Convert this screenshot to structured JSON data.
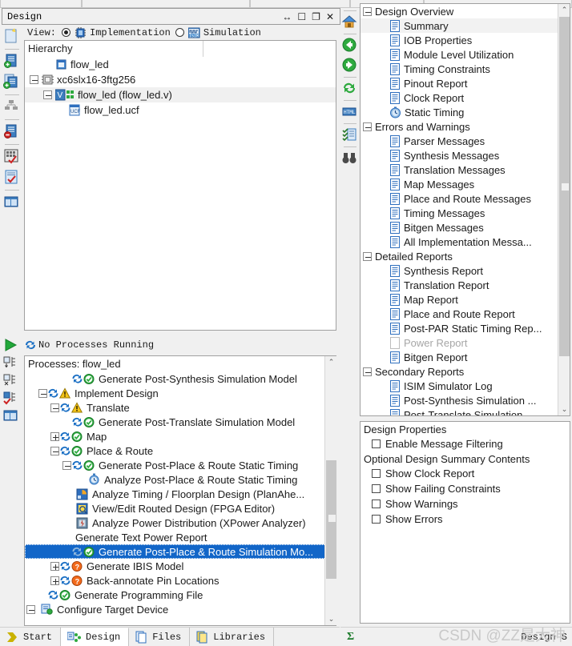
{
  "window": {
    "title": "Design",
    "buttons": [
      {
        "name": "resize-handle-icon",
        "glyph": "↔"
      },
      {
        "name": "maximize-icon",
        "glyph": "☐"
      },
      {
        "name": "restore-icon",
        "glyph": "❐"
      },
      {
        "name": "close-icon",
        "glyph": "✕"
      }
    ]
  },
  "view_selector": {
    "label": "View:",
    "options": [
      {
        "label": "Implementation",
        "selected": true,
        "icon": "chip-icon"
      },
      {
        "label": "Simulation",
        "selected": false,
        "icon": "waveform-icon"
      }
    ]
  },
  "hierarchy": {
    "header": "Hierarchy",
    "items": [
      {
        "label": "flow_led",
        "indent": 1,
        "toggle": "none",
        "icon": "project-icon",
        "selected": false
      },
      {
        "label": "xc6slx16-3ftg256",
        "indent": 0,
        "toggle": "minus",
        "icon": "device-icon",
        "selected": false
      },
      {
        "label": "flow_led (flow_led.v)",
        "indent": 1,
        "toggle": "minus",
        "icon": "verilog-module-icon",
        "selected": true
      },
      {
        "label": "flow_led.ucf",
        "indent": 2,
        "toggle": "none",
        "icon": "ucf-file-icon",
        "selected": false
      }
    ]
  },
  "processes": {
    "status": "No Processes Running",
    "title": "Processes: flow_led",
    "items": [
      {
        "label": "Generate Post-Synthesis Simulation Model",
        "indent": 3,
        "toggle": "none",
        "status": "ok",
        "icon": "process-icon",
        "selected": false
      },
      {
        "label": "Implement Design",
        "indent": 1,
        "toggle": "minus",
        "status": "warn",
        "icon": "process-icon",
        "selected": false
      },
      {
        "label": "Translate",
        "indent": 2,
        "toggle": "minus",
        "status": "warn",
        "icon": "process-icon",
        "selected": false
      },
      {
        "label": "Generate Post-Translate Simulation Model",
        "indent": 3,
        "toggle": "none",
        "status": "ok",
        "icon": "process-icon",
        "selected": false
      },
      {
        "label": "Map",
        "indent": 2,
        "toggle": "plus",
        "status": "ok",
        "icon": "process-icon",
        "selected": false
      },
      {
        "label": "Place & Route",
        "indent": 2,
        "toggle": "minus",
        "status": "ok",
        "icon": "process-icon",
        "selected": false
      },
      {
        "label": "Generate Post-Place & Route Static Timing",
        "indent": 3,
        "toggle": "minus",
        "status": "ok",
        "icon": "process-icon",
        "selected": false
      },
      {
        "label": "Analyze Post-Place & Route Static Timing",
        "indent": 4,
        "toggle": "none",
        "status": "none",
        "icon": "stopwatch-icon",
        "selected": false
      },
      {
        "label": "Analyze Timing / Floorplan Design (PlanAhe...",
        "indent": 3,
        "toggle": "none",
        "status": "none",
        "icon": "planahead-icon",
        "selected": false
      },
      {
        "label": "View/Edit Routed Design (FPGA Editor)",
        "indent": 3,
        "toggle": "none",
        "status": "none",
        "icon": "fpga-editor-icon",
        "selected": false
      },
      {
        "label": "Analyze Power Distribution (XPower Analyzer)",
        "indent": 3,
        "toggle": "none",
        "status": "none",
        "icon": "xpower-icon",
        "selected": false
      },
      {
        "label": "Generate Text Power Report",
        "indent": 3,
        "toggle": "none",
        "status": "none",
        "icon": "process-icon",
        "selected": false
      },
      {
        "label": "Generate Post-Place & Route Simulation Mo...",
        "indent": 3,
        "toggle": "none",
        "status": "ok",
        "icon": "process-icon",
        "selected": true
      },
      {
        "label": "Generate IBIS Model",
        "indent": 2,
        "toggle": "plus",
        "status": "question",
        "icon": "process-icon",
        "selected": false
      },
      {
        "label": "Back-annotate Pin Locations",
        "indent": 2,
        "toggle": "plus",
        "status": "question",
        "icon": "process-icon",
        "selected": false
      },
      {
        "label": "Generate Programming File",
        "indent": 1,
        "toggle": "none",
        "status": "ok",
        "icon": "process-icon",
        "selected": false
      },
      {
        "label": "Configure Target Device",
        "indent": 0,
        "toggle": "minus",
        "status": "none",
        "icon": "configure-icon",
        "selected": false
      }
    ]
  },
  "design_overview": {
    "items": [
      {
        "label": "Design Overview",
        "indent": 0,
        "toggle": "minus",
        "icon": "none",
        "selected": false,
        "disabled": false
      },
      {
        "label": "Summary",
        "indent": 1,
        "toggle": "none",
        "icon": "report-icon",
        "selected": true,
        "disabled": false
      },
      {
        "label": "IOB Properties",
        "indent": 1,
        "toggle": "none",
        "icon": "report-icon",
        "selected": false,
        "disabled": false
      },
      {
        "label": "Module Level Utilization",
        "indent": 1,
        "toggle": "none",
        "icon": "report-icon",
        "selected": false,
        "disabled": false
      },
      {
        "label": "Timing Constraints",
        "indent": 1,
        "toggle": "none",
        "icon": "report-icon",
        "selected": false,
        "disabled": false
      },
      {
        "label": "Pinout Report",
        "indent": 1,
        "toggle": "none",
        "icon": "report-icon",
        "selected": false,
        "disabled": false
      },
      {
        "label": "Clock Report",
        "indent": 1,
        "toggle": "none",
        "icon": "report-icon",
        "selected": false,
        "disabled": false
      },
      {
        "label": "Static Timing",
        "indent": 1,
        "toggle": "none",
        "icon": "static-timing-icon",
        "selected": false,
        "disabled": false
      },
      {
        "label": "Errors and Warnings",
        "indent": 0,
        "toggle": "minus",
        "icon": "none",
        "selected": false,
        "disabled": false
      },
      {
        "label": "Parser Messages",
        "indent": 1,
        "toggle": "none",
        "icon": "report-icon",
        "selected": false,
        "disabled": false
      },
      {
        "label": "Synthesis Messages",
        "indent": 1,
        "toggle": "none",
        "icon": "report-icon",
        "selected": false,
        "disabled": false
      },
      {
        "label": "Translation Messages",
        "indent": 1,
        "toggle": "none",
        "icon": "report-icon",
        "selected": false,
        "disabled": false
      },
      {
        "label": "Map Messages",
        "indent": 1,
        "toggle": "none",
        "icon": "report-icon",
        "selected": false,
        "disabled": false
      },
      {
        "label": "Place and Route Messages",
        "indent": 1,
        "toggle": "none",
        "icon": "report-icon",
        "selected": false,
        "disabled": false
      },
      {
        "label": "Timing Messages",
        "indent": 1,
        "toggle": "none",
        "icon": "report-icon",
        "selected": false,
        "disabled": false
      },
      {
        "label": "Bitgen Messages",
        "indent": 1,
        "toggle": "none",
        "icon": "report-icon",
        "selected": false,
        "disabled": false
      },
      {
        "label": "All Implementation Messa...",
        "indent": 1,
        "toggle": "none",
        "icon": "report-icon",
        "selected": false,
        "disabled": false
      },
      {
        "label": "Detailed Reports",
        "indent": 0,
        "toggle": "minus",
        "icon": "none",
        "selected": false,
        "disabled": false
      },
      {
        "label": "Synthesis Report",
        "indent": 1,
        "toggle": "none",
        "icon": "report-icon",
        "selected": false,
        "disabled": false
      },
      {
        "label": "Translation Report",
        "indent": 1,
        "toggle": "none",
        "icon": "report-icon",
        "selected": false,
        "disabled": false
      },
      {
        "label": "Map Report",
        "indent": 1,
        "toggle": "none",
        "icon": "report-icon",
        "selected": false,
        "disabled": false
      },
      {
        "label": "Place and Route Report",
        "indent": 1,
        "toggle": "none",
        "icon": "report-icon",
        "selected": false,
        "disabled": false
      },
      {
        "label": "Post-PAR Static Timing Rep...",
        "indent": 1,
        "toggle": "none",
        "icon": "report-icon",
        "selected": false,
        "disabled": false
      },
      {
        "label": "Power Report",
        "indent": 1,
        "toggle": "none",
        "icon": "report-disabled-icon",
        "selected": false,
        "disabled": true
      },
      {
        "label": "Bitgen Report",
        "indent": 1,
        "toggle": "none",
        "icon": "report-icon",
        "selected": false,
        "disabled": false
      },
      {
        "label": "Secondary Reports",
        "indent": 0,
        "toggle": "minus",
        "icon": "none",
        "selected": false,
        "disabled": false
      },
      {
        "label": "ISIM Simulator Log",
        "indent": 1,
        "toggle": "none",
        "icon": "report-icon",
        "selected": false,
        "disabled": false
      },
      {
        "label": "Post-Synthesis Simulation ...",
        "indent": 1,
        "toggle": "none",
        "icon": "report-icon",
        "selected": false,
        "disabled": false
      },
      {
        "label": "Post-Translate Simulation",
        "indent": 1,
        "toggle": "none",
        "icon": "report-icon",
        "selected": false,
        "disabled": false
      }
    ]
  },
  "design_properties": {
    "section1_title": "Design Properties",
    "section1_items": [
      {
        "label": "Enable Message Filtering",
        "checked": false
      }
    ],
    "section2_title": "Optional Design Summary Contents",
    "section2_items": [
      {
        "label": "Show Clock Report",
        "checked": false
      },
      {
        "label": "Show Failing Constraints",
        "checked": false
      },
      {
        "label": "Show Warnings",
        "checked": false
      },
      {
        "label": "Show Errors",
        "checked": false
      }
    ]
  },
  "left_toolbar": {
    "buttons": [
      {
        "name": "new-source-icon"
      },
      {
        "name": "add-source-icon"
      },
      {
        "name": "add-copy-source-icon"
      },
      {
        "name": "manage-configuration-icon"
      },
      {
        "name": "remove-source-icon"
      },
      {
        "name": "design-goals-icon"
      },
      {
        "name": "design-summary-icon"
      },
      {
        "name": "view-layout-icon"
      }
    ]
  },
  "process_toolbar": {
    "buttons": [
      {
        "name": "run-icon"
      },
      {
        "name": "rerun-icon"
      },
      {
        "name": "rerun-all-icon"
      },
      {
        "name": "stop-icon"
      },
      {
        "name": "process-view-icon"
      }
    ]
  },
  "right_toolbar": {
    "buttons": [
      {
        "name": "home-icon"
      },
      {
        "name": "back-icon"
      },
      {
        "name": "forward-icon"
      },
      {
        "name": "refresh-icon"
      },
      {
        "name": "html-icon"
      },
      {
        "name": "checklist-icon"
      },
      {
        "name": "find-icon"
      }
    ]
  },
  "bottom_tabs": {
    "left": [
      {
        "label": "Start",
        "icon": "start-icon",
        "active": false
      },
      {
        "label": "Design",
        "icon": "design-icon",
        "active": true
      },
      {
        "label": "Files",
        "icon": "files-icon",
        "active": false
      },
      {
        "label": "Libraries",
        "icon": "libraries-icon",
        "active": false
      }
    ],
    "right": [
      {
        "label": "Design S",
        "icon": "sigma-icon",
        "active": false
      }
    ]
  },
  "watermark": "CSDN @ZZ是大神",
  "colors": {
    "selection_blue": "#1266c8",
    "panel_bg": "#f0f0f0",
    "white": "#ffffff",
    "border": "#a0a0a0",
    "disabled_text": "#a6a6a6",
    "scrollbar_thumb": "#c6c6c6"
  }
}
